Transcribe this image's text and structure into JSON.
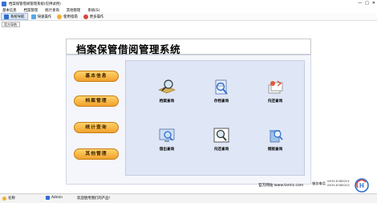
{
  "window": {
    "title": "档案保管借阅管理系统(仅供试用)",
    "controls": [
      "—",
      "□",
      "✕"
    ]
  },
  "menu": [
    "基本信息",
    "档案管理",
    "统计查询",
    "其他管理",
    "系统(S)"
  ],
  "toolbar": {
    "nav_label": "系统导航",
    "quick_label": "快速操作",
    "help_label": "使用指南",
    "more_label": "更多操作"
  },
  "panel_tab": "官方导航",
  "system_title": "档案保管借阅管理系统",
  "side_buttons": [
    "基本信息",
    "档案管理",
    "统计查询",
    "其他管理"
  ],
  "functions": [
    "档案查询",
    "存档查询",
    "归还查询",
    "借出查询",
    "归还查询",
    "销毁查询"
  ],
  "footer": {
    "site": "官方网站:www.tomis.com",
    "service": "服务电话",
    "phone1": "0635-8386201",
    "phone2": "0635-8386202"
  },
  "status": {
    "user_prefix": "名称",
    "user": "Admin",
    "welcome": "欢迎使用我们的产品!"
  },
  "colors": {
    "accent": "#2f6ccf",
    "button_gold": "#f2a12c",
    "panel_bg": "#dfe6f6"
  }
}
